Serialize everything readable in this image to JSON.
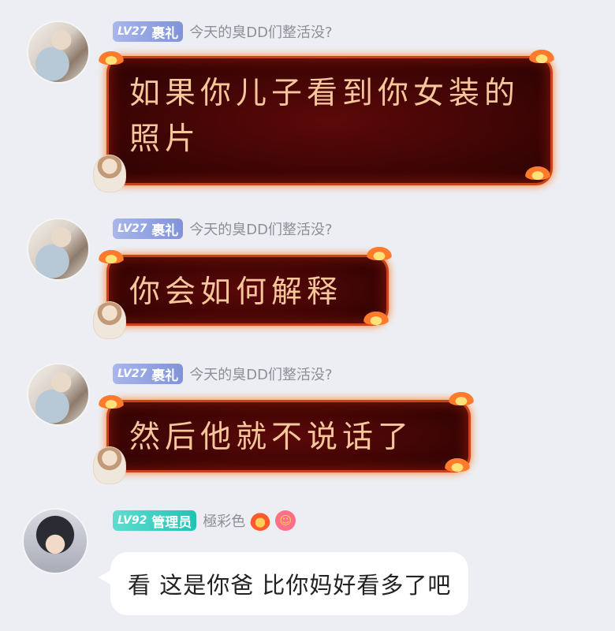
{
  "messages": [
    {
      "level": "LV27",
      "name": "裹礼",
      "title": "今天的臭DD们整活没?",
      "text": "如果你儿子看到你女装的照片"
    },
    {
      "level": "LV27",
      "name": "裹礼",
      "title": "今天的臭DD们整活没?",
      "text": "你会如何解释"
    },
    {
      "level": "LV27",
      "name": "裹礼",
      "title": "今天的臭DD们整活没?",
      "text": "然后他就不说话了"
    },
    {
      "level": "LV92",
      "name": "管理员",
      "title": "極彩色",
      "emojis": [
        "fire-emoji",
        "smile-emoji"
      ],
      "text": "看 这是你爸 比你妈好看多了吧"
    }
  ],
  "colors": {
    "background": "#eceef3",
    "level_badge_blue": "#8092da",
    "level_badge_teal": "#22c3b4",
    "fire_bubble": "#3f0505",
    "fire_text": "#f6c79b"
  }
}
